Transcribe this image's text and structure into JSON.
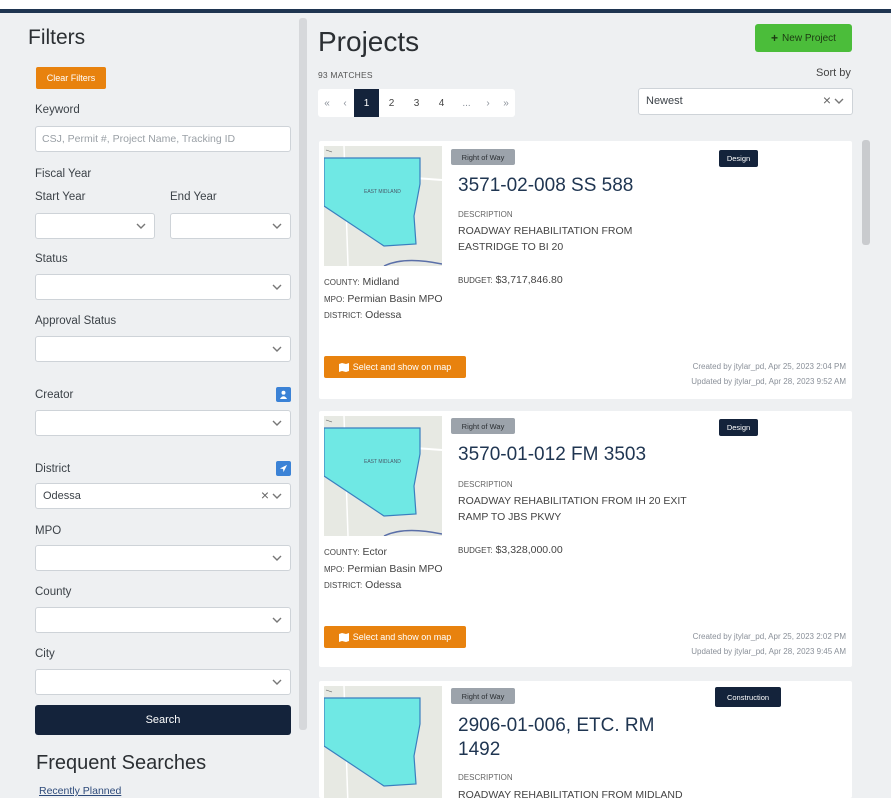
{
  "sidebar": {
    "title": "Filters",
    "clear_filters": "Clear Filters",
    "keyword_label": "Keyword",
    "keyword_placeholder": "CSJ, Permit #, Project Name, Tracking ID",
    "fiscal_year_label": "Fiscal Year",
    "start_year_label": "Start Year",
    "end_year_label": "End Year",
    "status_label": "Status",
    "approval_status_label": "Approval Status",
    "creator_label": "Creator",
    "district_label": "District",
    "district_value": "Odessa",
    "mpo_label": "MPO",
    "county_label": "County",
    "city_label": "City",
    "search_button": "Search",
    "frequent_searches_title": "Frequent Searches",
    "frequent_link": "Recently Planned"
  },
  "main": {
    "title": "Projects",
    "new_project": "New Project",
    "matches": "93 MATCHES",
    "sort_by_label": "Sort by",
    "sort_value": "Newest",
    "pager": {
      "first": "«",
      "prev": "‹",
      "pages": [
        "1",
        "2",
        "3",
        "4"
      ],
      "active_page": "1",
      "ellipsis": "...",
      "next": "›",
      "last": "»"
    }
  },
  "labels": {
    "description": "DESCRIPTION",
    "budget": "BUDGET:",
    "county": "COUNTY:",
    "mpo": "MPO:",
    "district": "DISTRICT:",
    "select_map": "Select and show on map"
  },
  "projects": [
    {
      "category": "Right of Way",
      "phase": "Design",
      "title": "3571-02-008 SS 588",
      "description": "ROADWAY REHABILITATION FROM EASTRIDGE TO BI 20",
      "budget": "$3,717,846.80",
      "county": "Midland",
      "mpo": "Permian Basin MPO",
      "district": "Odessa",
      "created": "Created by jtylar_pd, Apr 25, 2023 2:04 PM",
      "updated": "Updated by jtylar_pd, Apr 28, 2023 9:52 AM"
    },
    {
      "category": "Right of Way",
      "phase": "Design",
      "title": "3570-01-012 FM 3503",
      "description": "ROADWAY REHABILITATION FROM IH 20 EXIT RAMP TO JBS PKWY",
      "budget": "$3,328,000.00",
      "county": "Ector",
      "mpo": "Permian Basin MPO",
      "district": "Odessa",
      "created": "Created by jtylar_pd, Apr 25, 2023 2:02 PM",
      "updated": "Updated by jtylar_pd, Apr 28, 2023 9:45 AM"
    },
    {
      "category": "Right of Way",
      "phase": "Construction",
      "title": "2906-01-006, ETC. RM 1492",
      "description": "ROADWAY REHABILITATION FROM MIDLAND"
    }
  ],
  "colors": {
    "navy": "#14233b",
    "orange": "#e8820e",
    "green": "#4bbd3a",
    "blue": "#3b82d6"
  }
}
